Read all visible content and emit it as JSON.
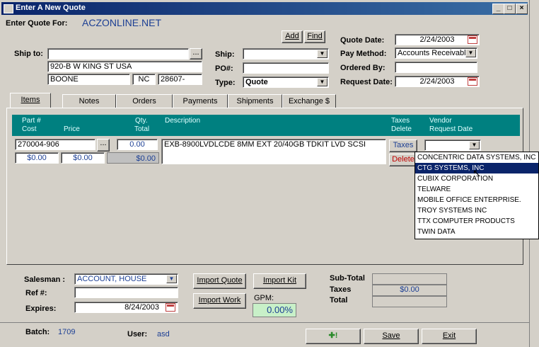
{
  "window": {
    "title": "Enter A New Quote",
    "min": "_",
    "max": "□",
    "close": "×"
  },
  "header": {
    "quote_for_label": "Enter Quote For:",
    "customer": "ACZONLINE.NET",
    "add_label": "Add",
    "find_label": "Find"
  },
  "ship_to": {
    "label": "Ship to:",
    "name": "",
    "address": "920-B W KING ST    USA",
    "city": "BOONE",
    "state": "NC",
    "zip": "28607-",
    "browse": "..."
  },
  "ship": {
    "label": "Ship:",
    "value": ""
  },
  "po": {
    "label": "PO#:",
    "value": ""
  },
  "type": {
    "label": "Type:",
    "value": "Quote"
  },
  "right_form": {
    "quote_date_label": "Quote Date:",
    "quote_date": "2/24/2003",
    "pay_method_label": "Pay Method:",
    "pay_method": "Accounts Receivabl",
    "ordered_by_label": "Ordered By:",
    "ordered_by": "",
    "request_date_label": "Request Date:",
    "request_date": "2/24/2003"
  },
  "tabs": [
    "Items",
    "Notes",
    "Orders",
    "Payments",
    "Shipments",
    "Exchange $"
  ],
  "grid_header": {
    "part": "Part #",
    "cost": "Cost",
    "price": "Price",
    "qty": "Qty.",
    "total": "Total",
    "description": "Description",
    "taxes": "Taxes",
    "delete": "Delete",
    "vendor": "Vendor",
    "request_date": "Request Date"
  },
  "item": {
    "part": "270004-906",
    "browse": "...",
    "qty": "0.00",
    "description": "EXB-8900LVDLCDE 8MM EXT 20/40GB TDKIT LVD SCSI",
    "cost": "$0.00",
    "price": "$0.00",
    "total": "$0.00",
    "taxes_button": "Taxes",
    "delete_button": "Delete",
    "vendor": ""
  },
  "vendor_list": [
    "CONCENTRIC DATA SYSTEMS, INC",
    "CTG SYSTEMS, INC",
    "CUBIX CORPORATION",
    "TELWARE",
    "MOBILE OFFICE ENTERPRISE.",
    "TROY SYSTEMS INC",
    "TTX COMPUTER PRODUCTS",
    "TWIN DATA"
  ],
  "vendor_selected_index": 1,
  "bottom": {
    "salesman_label": "Salesman :",
    "salesman": "ACCOUNT, HOUSE",
    "ref_label": "Ref #:",
    "ref": "",
    "expires_label": "Expires:",
    "expires": "8/24/2003",
    "import_quote": "Import Quote",
    "import_kit": "Import Kit",
    "import_work": "Import Work",
    "gpm_label": "GPM:",
    "gpm": "0.00%",
    "subtotal_label": "Sub-Total",
    "subtotal": "",
    "taxes_label": "Taxes",
    "taxes": "$0.00",
    "total_label": "Total",
    "total": ""
  },
  "status": {
    "batch_label": "Batch:",
    "batch": "1709",
    "user_label": "User:",
    "user": "asd",
    "new_button": "✚!",
    "save": "Save",
    "exit": "Exit"
  },
  "colors": {
    "title_bar": "#0a246a",
    "grid_header": "#008080",
    "customer_text": "#1c3f94",
    "gpm_bg": "#c8f0c8"
  }
}
